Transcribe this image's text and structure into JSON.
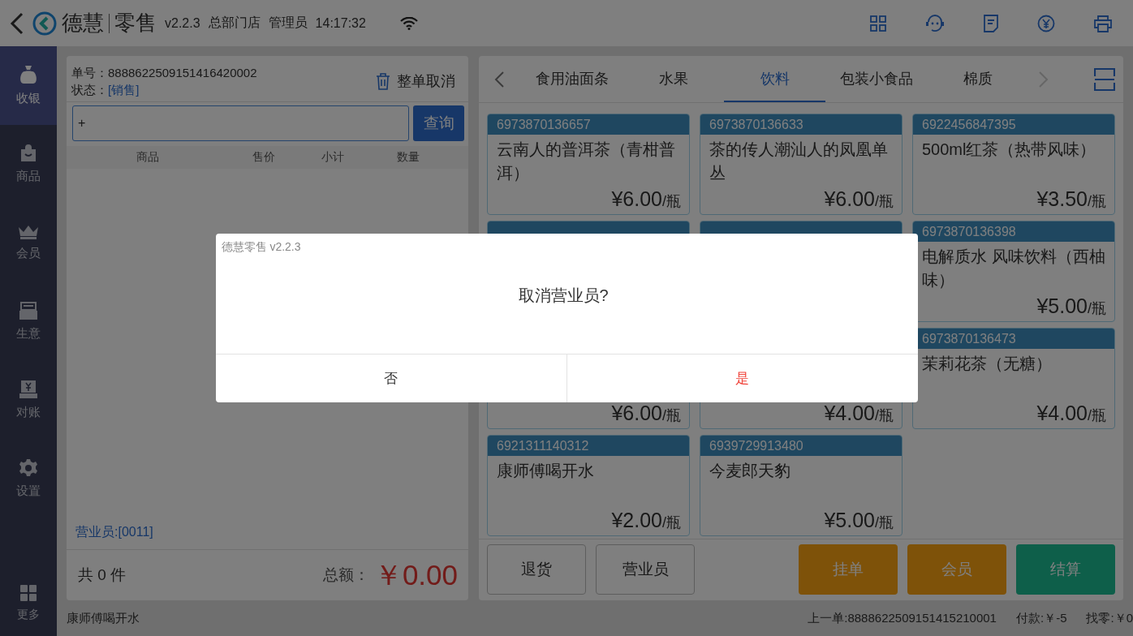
{
  "header": {
    "brand": "德慧",
    "product": "零售",
    "version": "v2.2.3",
    "store": "总部门店",
    "user": "管理员",
    "time": "14:17:32"
  },
  "sidebar": {
    "items": [
      {
        "label": "收银",
        "selected": true
      },
      {
        "label": "商品",
        "selected": false
      },
      {
        "label": "会员",
        "selected": false
      },
      {
        "label": "生意",
        "selected": false
      },
      {
        "label": "对账",
        "selected": false
      },
      {
        "label": "设置",
        "selected": false
      }
    ],
    "more": {
      "label": "更多"
    }
  },
  "order": {
    "number_label": "单号：",
    "number": "8888622509151416420002",
    "status_label": "状态：",
    "status": "[销售]",
    "cancel": "整单取消",
    "search_value": "+",
    "search_button": "查询",
    "columns": [
      "商品",
      "售价",
      "小计",
      "数量"
    ],
    "clerk": "营业员:[0011]",
    "count": "共 0 件",
    "total_label": "总额：",
    "total": "￥0.00"
  },
  "categories": {
    "tabs": [
      {
        "label": "食用油面条",
        "selected": false
      },
      {
        "label": "水果",
        "selected": false
      },
      {
        "label": "饮料",
        "selected": true
      },
      {
        "label": "包装小食品",
        "selected": false
      },
      {
        "label": "棉质",
        "selected": false
      }
    ],
    "next_disabled": true
  },
  "products": [
    {
      "kind": "product",
      "code": "6973870136657",
      "name": "云南人的普洱茶（青柑普洱）",
      "price": "¥6.00",
      "unit": "/瓶"
    },
    {
      "kind": "product",
      "code": "6973870136633",
      "name": "茶的传人潮汕人的凤凰单丛",
      "price": "¥6.00",
      "unit": "/瓶"
    },
    {
      "kind": "product",
      "code": "6922456847395",
      "name": "500ml红茶（热带风味）",
      "price": "¥3.50",
      "unit": "/瓶"
    },
    {
      "kind": "covered"
    },
    {
      "kind": "covered"
    },
    {
      "kind": "product",
      "code": "6973870136398",
      "name": "电解质水 风味饮料（西柚味）",
      "price": "¥5.00",
      "unit": "/瓶"
    },
    {
      "kind": "product",
      "price": "¥6.00",
      "unit": "/瓶"
    },
    {
      "kind": "product",
      "price": "¥4.00",
      "unit": "/瓶"
    },
    {
      "kind": "product",
      "code": "6973870136473",
      "name": "茉莉花茶（无糖）",
      "price": "¥4.00",
      "unit": "/瓶"
    },
    {
      "kind": "product",
      "code": "6921311140312",
      "name": "康师傅喝开水",
      "price": "¥2.00",
      "unit": "/瓶"
    },
    {
      "kind": "product",
      "code": "6939729913480",
      "name": "今麦郎天豹",
      "price": "¥5.00",
      "unit": "/瓶"
    }
  ],
  "actions": [
    {
      "label": "退货",
      "kind": "plain"
    },
    {
      "label": "营业员",
      "kind": "plain"
    },
    {
      "label": "挂单",
      "kind": "accent"
    },
    {
      "label": "会员",
      "kind": "accent"
    },
    {
      "label": "结算",
      "kind": "primary"
    }
  ],
  "status_bar": {
    "last_item": "康师傅喝开水",
    "last_order": "上一单:8888622509151415210001",
    "paid": "付款:￥-5",
    "change": "找零:￥0"
  },
  "dialog": {
    "title": "德慧零售 v2.2.3",
    "message": "取消营业员?",
    "buttons": [
      {
        "label": "否",
        "kind": "cancel"
      },
      {
        "label": "是",
        "kind": "confirm"
      }
    ]
  }
}
